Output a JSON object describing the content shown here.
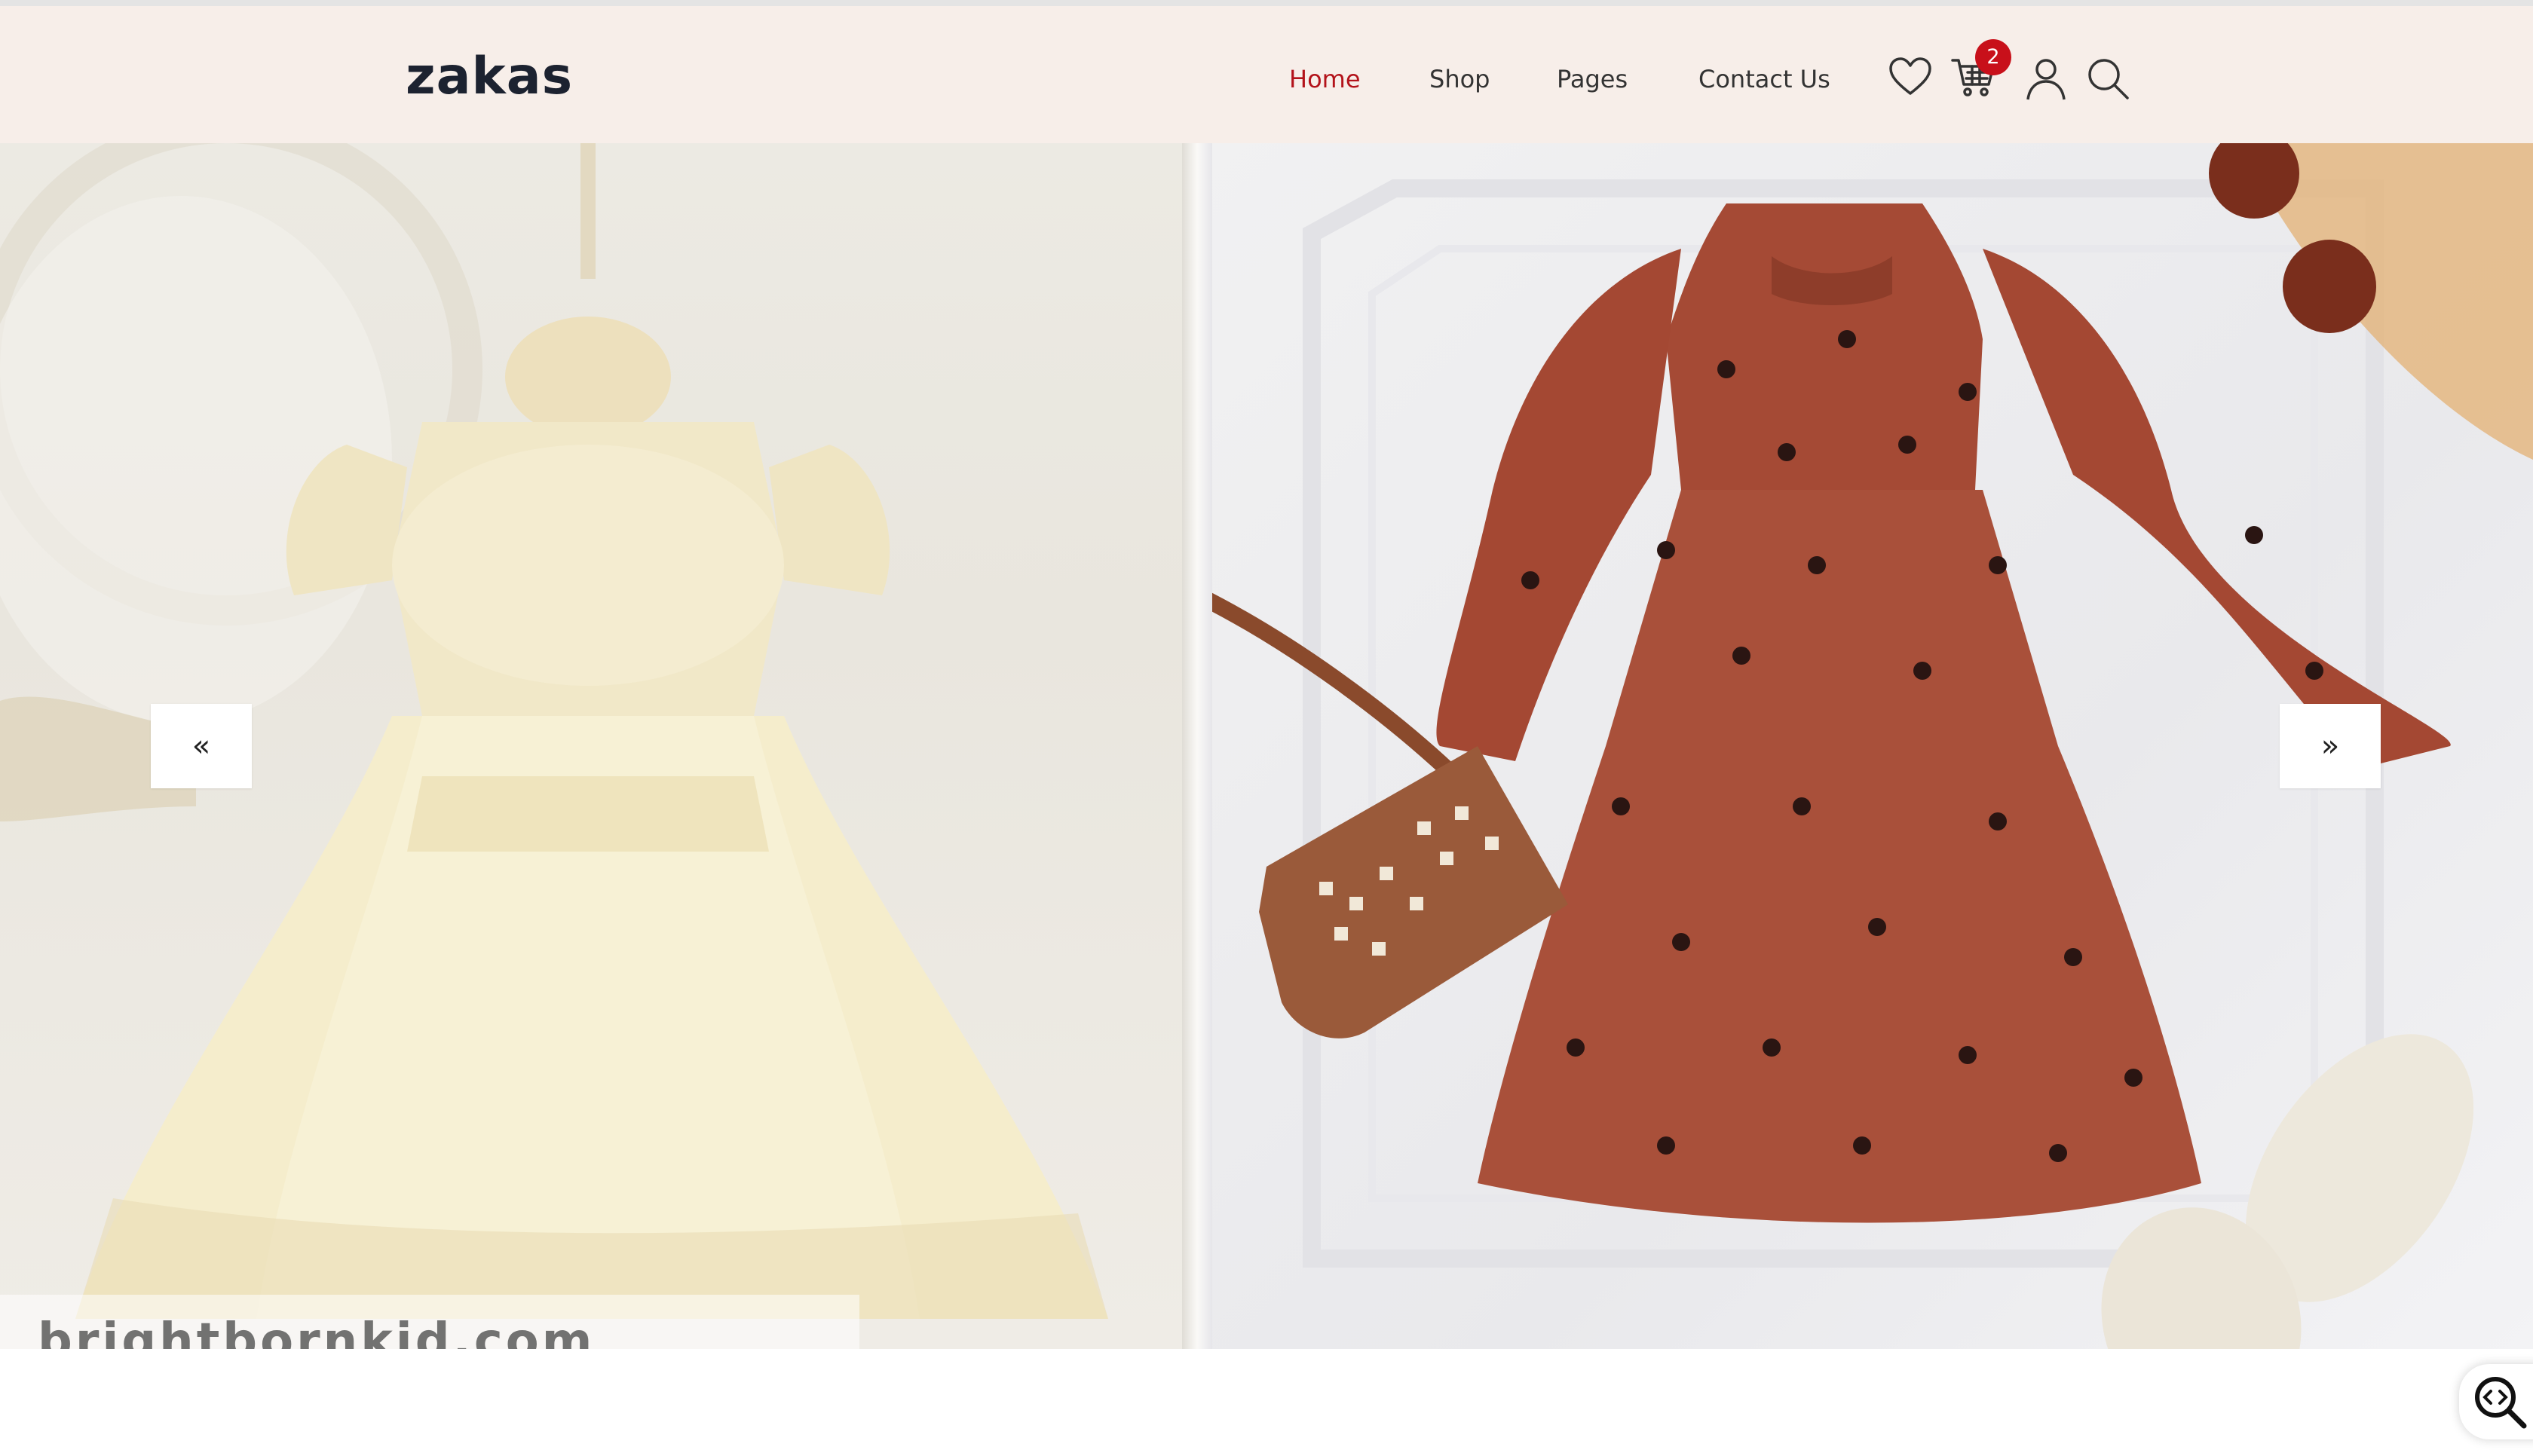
{
  "brand": {
    "logo_text": "zakas"
  },
  "nav": {
    "items": [
      {
        "label": "Home",
        "active": true
      },
      {
        "label": "Shop",
        "active": false
      },
      {
        "label": "Pages",
        "active": false
      },
      {
        "label": "Contact Us",
        "active": false
      }
    ]
  },
  "header_icons": {
    "wishlist": "heart-icon",
    "cart": "cart-icon",
    "cart_count": "2",
    "account": "user-icon",
    "search": "search-icon"
  },
  "hero": {
    "prev_label": "«",
    "next_label": "»",
    "watermark_text": "brightbornkid.com"
  },
  "colors": {
    "accent": "#b3131b",
    "badge": "#c8101a",
    "header_bg": "#f7eee9",
    "logo": "#1c2230"
  },
  "floating_widget": {
    "icon": "code-search-icon"
  }
}
